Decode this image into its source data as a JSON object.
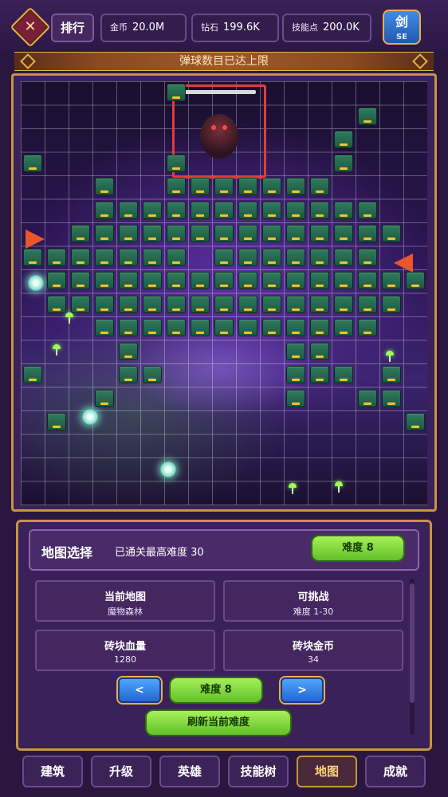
{
  "top_bar": {
    "rank_label": "排行",
    "stats": [
      {
        "label": "金币",
        "value": "20.0M"
      },
      {
        "label": "钻石",
        "value": "199.6K"
      },
      {
        "label": "技能点",
        "value": "200.0K"
      }
    ],
    "sword_label": "剑",
    "sword_sub": "SE"
  },
  "banner": {
    "text": "弹球数目已达上限"
  },
  "map_panel": {
    "title": "地图选择",
    "cleared_text": "已通关最高难度 30",
    "difficulty_badge": "难度 8",
    "cards": [
      {
        "title": "当前地图",
        "value": "魔物森林"
      },
      {
        "title": "可挑战",
        "value": "难度 1-30"
      },
      {
        "title": "砖块血量",
        "value": "1280"
      },
      {
        "title": "砖块金币",
        "value": "34"
      }
    ],
    "prev_label": "<",
    "next_label": ">",
    "current_difficulty": "难度 8",
    "refresh_label": "刷新当前难度"
  },
  "nav": {
    "items": [
      "建筑",
      "升级",
      "英雄",
      "技能树",
      "地图",
      "成就"
    ],
    "active_index": 4
  },
  "colors": {
    "background": "#2a1740",
    "gold_border": "#c89440",
    "brick": "#2f7a5c",
    "brick_stripe": "#f1c330",
    "boss_frame": "#e23c3c",
    "green_button": "#a6f05a",
    "blue_button": "#4ea6ff"
  }
}
